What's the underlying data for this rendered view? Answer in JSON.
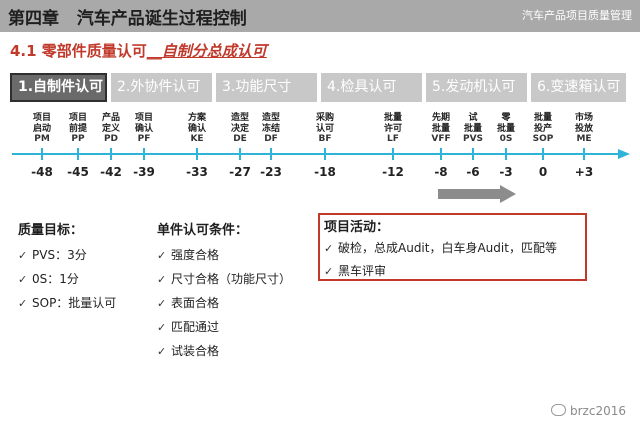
{
  "header": {
    "chapter": "第四章",
    "title": "汽车产品诞生过程控制",
    "right": "汽车产品项目质量管理"
  },
  "subtitle": {
    "prefix": "4.1 零部件质量认可",
    "link": "__自制分总成认可"
  },
  "tabs": [
    {
      "label": "1.自制件认可",
      "active": true
    },
    {
      "label": "2.外协件认可",
      "active": false
    },
    {
      "label": "3.功能尺寸",
      "active": false
    },
    {
      "label": "4.检具认可",
      "active": false
    },
    {
      "label": "5.发动机认可",
      "active": false
    },
    {
      "label": "6.变速箱认可",
      "active": false
    }
  ],
  "milestones": [
    {
      "lines": [
        "项目",
        "启动"
      ],
      "code": "PM",
      "value": "-48"
    },
    {
      "lines": [
        "项目",
        "前提"
      ],
      "code": "PP",
      "value": "-45"
    },
    {
      "lines": [
        "产品",
        "定义"
      ],
      "code": "PD",
      "value": "-42"
    },
    {
      "lines": [
        "项目",
        "确认"
      ],
      "code": "PF",
      "value": "-39"
    },
    {
      "lines": [
        "方案",
        "确认"
      ],
      "code": "KE",
      "value": "-33"
    },
    {
      "lines": [
        "造型",
        "决定"
      ],
      "code": "DE",
      "value": "-27"
    },
    {
      "lines": [
        "造型",
        "冻结"
      ],
      "code": "DF",
      "value": "-23"
    },
    {
      "lines": [
        "采购",
        "认可"
      ],
      "code": "BF",
      "value": "-18"
    },
    {
      "lines": [
        "批量",
        "许可"
      ],
      "code": "LF",
      "value": "-12"
    },
    {
      "lines": [
        "先期",
        "批量"
      ],
      "code": "VFF",
      "value": "-8"
    },
    {
      "lines": [
        "试",
        "批量"
      ],
      "code": "PVS",
      "value": "-6"
    },
    {
      "lines": [
        "零",
        "批量"
      ],
      "code": "0S",
      "value": "-3"
    },
    {
      "lines": [
        "批量",
        "投产"
      ],
      "code": "SOP",
      "value": "0"
    },
    {
      "lines": [
        "市场",
        "投放"
      ],
      "code": "ME",
      "value": "+3"
    }
  ],
  "colors": {
    "timeline": "#2eb4d8",
    "accent": "#c0392b",
    "arrow": "#8c8c8c"
  },
  "quality_goals": {
    "title": "质量目标：",
    "items": [
      "PVS：3分",
      "0S：1分",
      "SOP：批量认可"
    ]
  },
  "conditions": {
    "title": "单件认可条件：",
    "items": [
      "强度合格",
      "尺寸合格（功能尺寸）",
      "表面合格",
      "匹配通过",
      "试装合格"
    ]
  },
  "activities": {
    "title": "项目活动：",
    "items": [
      "破检，总成Audit，白车身Audit，匹配等",
      "黑车评审"
    ]
  },
  "brand": "brzc2016",
  "check_icon": "check-icon"
}
